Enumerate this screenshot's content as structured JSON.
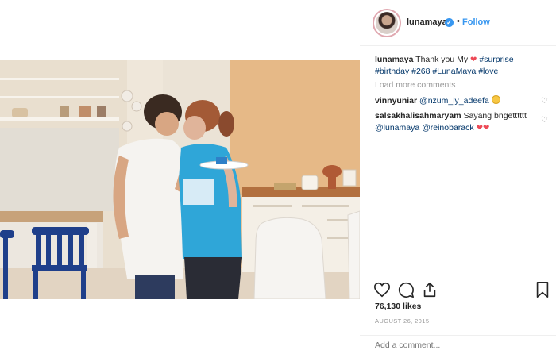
{
  "post": {
    "username": "lunamaya",
    "follow_label": "Follow",
    "dot": "•",
    "verified_mark": "✓"
  },
  "caption": {
    "username": "lunamaya",
    "text": " Thank you My ",
    "heart": "❤",
    "tags": [
      "#surprise",
      "#birthday",
      "#268",
      "#LunaMaya",
      "#love"
    ]
  },
  "load_more": "Load more comments",
  "comments": [
    {
      "username": "vinnyuniar",
      "mention": "@nzum_ly_adeefa",
      "emoji": "laughing-tears"
    },
    {
      "username": "salsakhalisahmaryam",
      "text": " Sayang bngetttttt",
      "mentions": [
        "@lunamaya",
        "@reinobarack"
      ],
      "hearts": "❤❤"
    }
  ],
  "likes": "76,130 likes",
  "date": "AUGUST 26, 2015",
  "add_comment_placeholder": "Add a comment...",
  "icons": [
    "heart-outline-icon",
    "comment-icon",
    "share-icon",
    "bookmark-icon",
    "verified-badge-icon",
    "small-heart-icon"
  ],
  "colors": {
    "link": "#3897f0",
    "hashtag": "#003569",
    "heart": "#ed4956",
    "muted": "#999999"
  }
}
